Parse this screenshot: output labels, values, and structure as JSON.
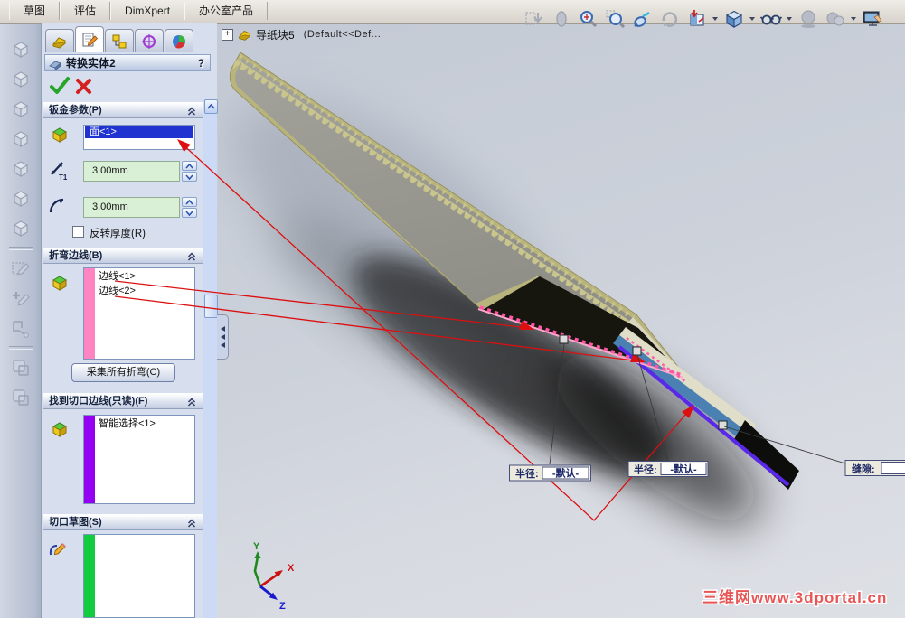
{
  "menu_tabs": [
    "草图",
    "评估",
    "DimXpert",
    "办公室产品"
  ],
  "view_toolbar_icons": [
    "previous-view",
    "zoom-in-out",
    "zoom-to-fit",
    "zoom-to-area",
    "zoom-to-selection",
    "rotate-view",
    "section-view",
    "view-orientation",
    "display-style",
    "shadows",
    "realview",
    "apply-scene"
  ],
  "left_toolbar_icons": [
    "feature-cube-1",
    "feature-cube-2",
    "feature-cube-3",
    "feature-cube-4",
    "feature-cube-5",
    "feature-cube-6",
    "feature-cube-7",
    "edit-sketch",
    "add-sketch",
    "convert-entities",
    "derived-part-1",
    "derived-part-2"
  ],
  "ui_glyphs": {
    "expand_plus": "+",
    "help": "?"
  },
  "feature_tree": {
    "part_name": "导纸块5",
    "configuration": "(Default<<Def..."
  },
  "property_manager": {
    "title": "转换实体2",
    "thickness_icon_label": "T1",
    "sections": {
      "sheet_metal": {
        "header": "钣金参数(P)",
        "face_selection": "面<1>",
        "thickness_value": "3.00mm",
        "radius_value": "3.00mm",
        "reverse_thickness_label": "反转厚度(R)"
      },
      "bend_edges": {
        "header": "折弯边线(B)",
        "items": [
          "边线<1>",
          "边线<2>"
        ],
        "collect_button": "采集所有折弯(C)"
      },
      "rip_edges": {
        "header": "找到切口边线(只读)(F)",
        "items": [
          "智能选择<1>"
        ]
      },
      "rip_sketches": {
        "header": "切口草图(S)",
        "items": []
      }
    }
  },
  "viewport": {
    "callout_radius_1": {
      "label": "半径:",
      "value": "-默认-"
    },
    "callout_radius_2": {
      "label": "半径:",
      "value": "-默认-"
    },
    "callout_gap": {
      "label": "缝隙:",
      "value": ""
    },
    "triad": {
      "x": "X",
      "y": "Y",
      "z": "Z"
    },
    "watermark": "三维网www.3dportal.cn"
  },
  "colors": {
    "selection_blue": "#2032d0",
    "field_green": "#d9efd6",
    "bend_stripe_pink": "#ff85c2",
    "rip_stripe_purple": "#9400f2",
    "sketch_stripe_green": "#12cc3e",
    "leader_red": "#dc1010",
    "plate_tan": "#b9b47c",
    "plate_gray": "#9b9b94"
  }
}
